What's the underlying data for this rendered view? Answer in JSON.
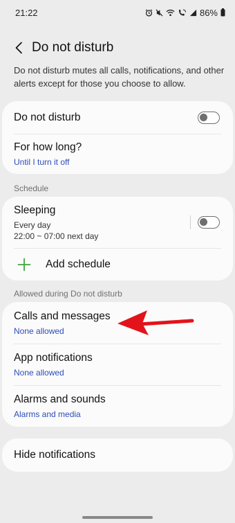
{
  "status_bar": {
    "time": "21:22",
    "battery": "86%",
    "icons": [
      "alarm-icon",
      "mute-icon",
      "wifi-icon",
      "wifi-calling-icon",
      "signal-icon",
      "battery-icon"
    ]
  },
  "header": {
    "title": "Do not disturb"
  },
  "description": "Do not disturb mutes all calls, notifications, and other alerts except for those you choose to allow.",
  "main_card": {
    "dnd_label": "Do not disturb",
    "dnd_enabled": false,
    "duration_label": "For how long?",
    "duration_value": "Until I turn it off"
  },
  "schedule": {
    "section_label": "Schedule",
    "items": [
      {
        "title": "Sleeping",
        "days": "Every day",
        "time": "22:00 ~ 07:00 next day",
        "enabled": false
      }
    ],
    "add_label": "Add schedule"
  },
  "allowed": {
    "section_label": "Allowed during Do not disturb",
    "items": [
      {
        "title": "Calls and messages",
        "subtitle": "None allowed"
      },
      {
        "title": "App notifications",
        "subtitle": "None allowed"
      },
      {
        "title": "Alarms and sounds",
        "subtitle": "Alarms and media"
      }
    ]
  },
  "hide_notifications": {
    "label": "Hide notifications"
  },
  "colors": {
    "background": "#ececec",
    "card": "#fbfbfb",
    "link_blue": "#2c4dbb",
    "plus_green": "#3fa33f",
    "annotation_red": "#e3131b"
  }
}
